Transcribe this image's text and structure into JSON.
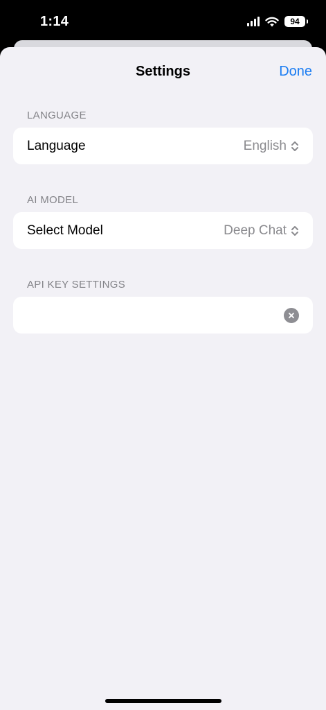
{
  "status_bar": {
    "time": "1:14",
    "battery": "94"
  },
  "nav": {
    "title": "Settings",
    "done_label": "Done"
  },
  "sections": {
    "language": {
      "header": "LANGUAGE",
      "row_label": "Language",
      "row_value": "English"
    },
    "ai_model": {
      "header": "AI MODEL",
      "row_label": "Select Model",
      "row_value": "Deep Chat"
    },
    "api_key": {
      "header": "API KEY SETTINGS",
      "value": ""
    }
  },
  "colors": {
    "accent": "#1a7cf2",
    "background": "#f2f1f6",
    "secondary_text": "#8a8a8e"
  }
}
